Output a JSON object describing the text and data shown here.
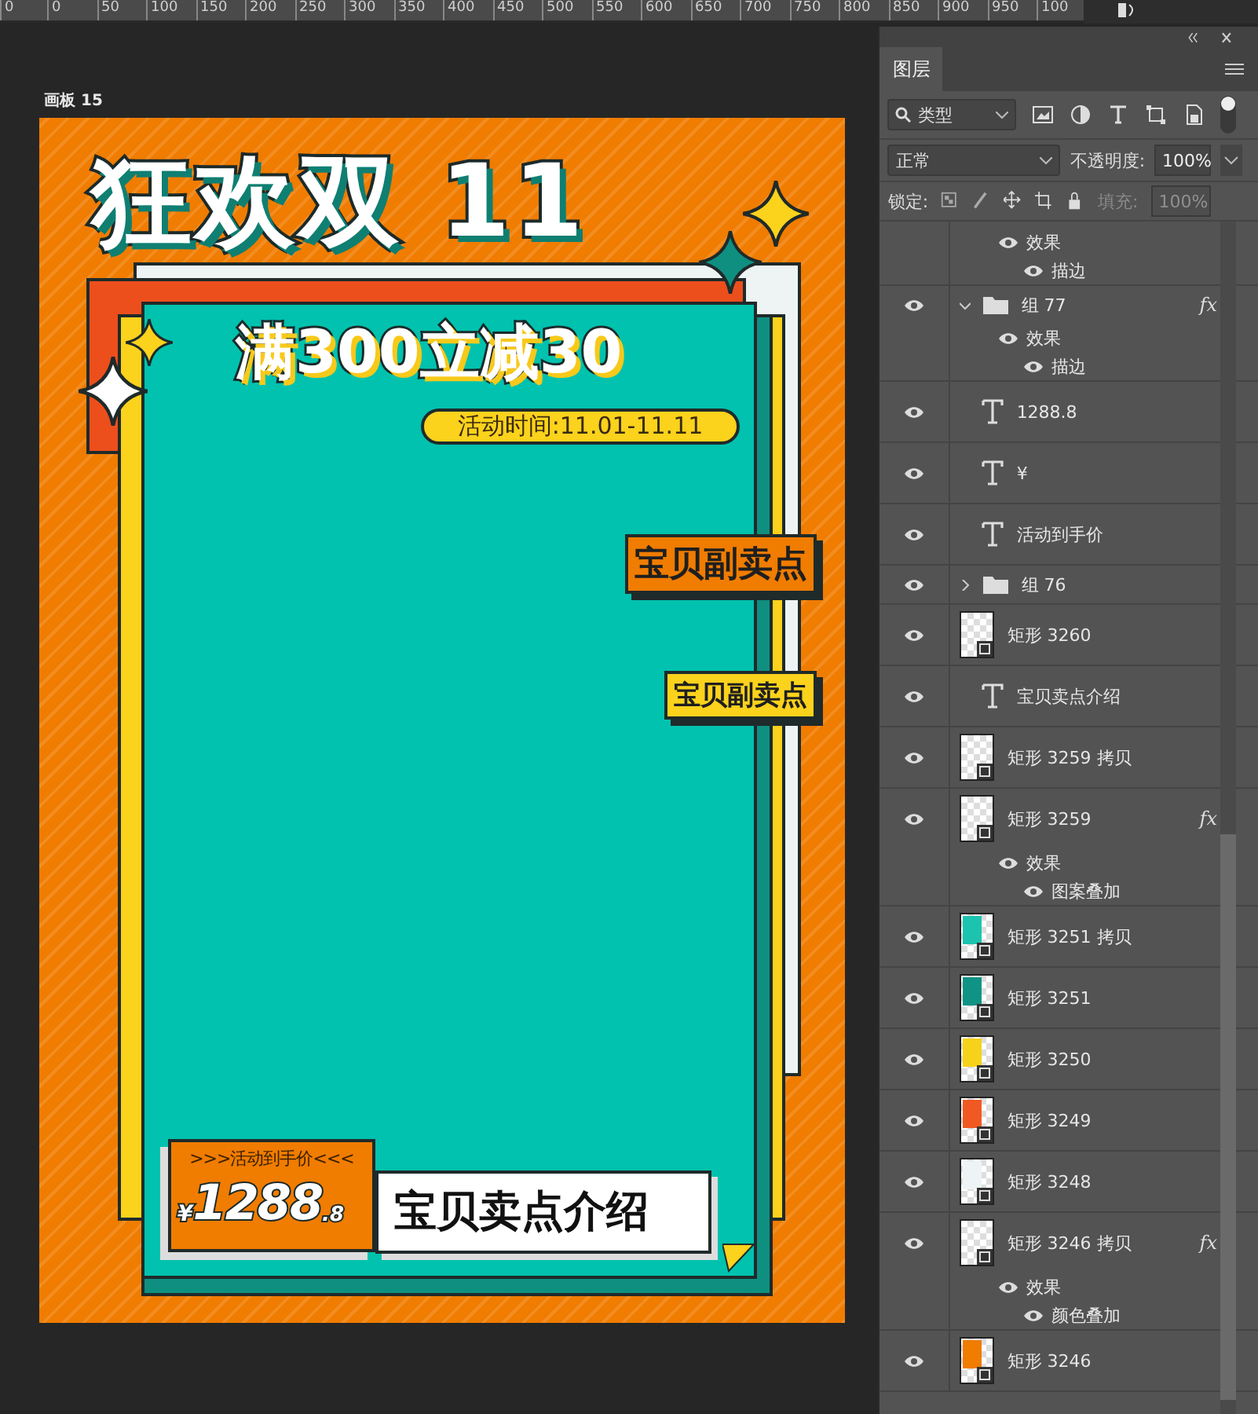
{
  "ruler": {
    "labels": [
      "0",
      "0",
      "50",
      "100",
      "150",
      "200",
      "250",
      "300",
      "350",
      "400",
      "450",
      "500",
      "550",
      "600",
      "650",
      "700",
      "750",
      "800",
      "850",
      "900",
      "950",
      "100"
    ]
  },
  "artboard": {
    "label": "画板 15",
    "title": "狂欢双 11",
    "offer": "满300立减30",
    "period": "活动时间:11.01-11.11",
    "tags": [
      {
        "text": "宝贝副卖点",
        "color": "#f07c00"
      },
      {
        "text": "宝贝副卖点",
        "color": "#fbd21c"
      }
    ],
    "price_badge": {
      "caption": ">>>活动到手价<<<",
      "currency": "¥",
      "amount": "1288",
      "decimal": ".8"
    },
    "headline": "宝贝卖点介绍"
  },
  "panel": {
    "tab": {
      "label": "图层",
      "selected": true
    },
    "filter": {
      "value": "类型"
    },
    "blend": {
      "value": "正常"
    },
    "opacity": {
      "label": "不透明度:",
      "value": "100%"
    },
    "lock": {
      "label": "锁定:"
    },
    "fill": {
      "label": "填充:",
      "value": "100%",
      "disabled": true
    },
    "layers": [
      {
        "kind": "effects-tail",
        "effects_label": "效果",
        "effects": [
          "描边"
        ]
      },
      {
        "kind": "group",
        "name": "组 77",
        "visible": true,
        "expanded": true,
        "fx": "fx",
        "effects_label": "效果",
        "effects": [
          "描边"
        ],
        "children": [
          {
            "kind": "text",
            "name": "1288.8",
            "visible": true
          },
          {
            "kind": "text",
            "name": "¥",
            "visible": true
          }
        ]
      },
      {
        "kind": "text",
        "name": "活动到手价",
        "visible": true
      },
      {
        "kind": "group",
        "name": "组 76",
        "visible": true,
        "expanded": false
      },
      {
        "kind": "shape",
        "name": "矩形 3260",
        "visible": true
      },
      {
        "kind": "text",
        "name": "宝贝卖点介绍",
        "visible": true
      },
      {
        "kind": "shape",
        "name": "矩形 3259 拷贝",
        "visible": true
      },
      {
        "kind": "shape",
        "name": "矩形 3259",
        "visible": true,
        "fx": "fx",
        "effects_label": "效果",
        "effects": [
          "图案叠加"
        ]
      },
      {
        "kind": "shape",
        "name": "矩形 3251 拷贝",
        "visible": true,
        "color": "#1cc4b0"
      },
      {
        "kind": "shape",
        "name": "矩形 3251",
        "visible": true,
        "color": "#0f9384"
      },
      {
        "kind": "shape",
        "name": "矩形 3250",
        "visible": true,
        "color": "#f7d21a"
      },
      {
        "kind": "shape",
        "name": "矩形 3249",
        "visible": true,
        "color": "#f05a22"
      },
      {
        "kind": "shape",
        "name": "矩形 3248",
        "visible": true,
        "color": "#eef4f5"
      },
      {
        "kind": "shape",
        "name": "矩形 3246 拷贝",
        "visible": true,
        "fx": "fx",
        "effects_label": "效果",
        "effects": [
          "颜色叠加"
        ]
      },
      {
        "kind": "shape",
        "name": "矩形 3246",
        "visible": true,
        "color": "#f07c00"
      }
    ]
  }
}
